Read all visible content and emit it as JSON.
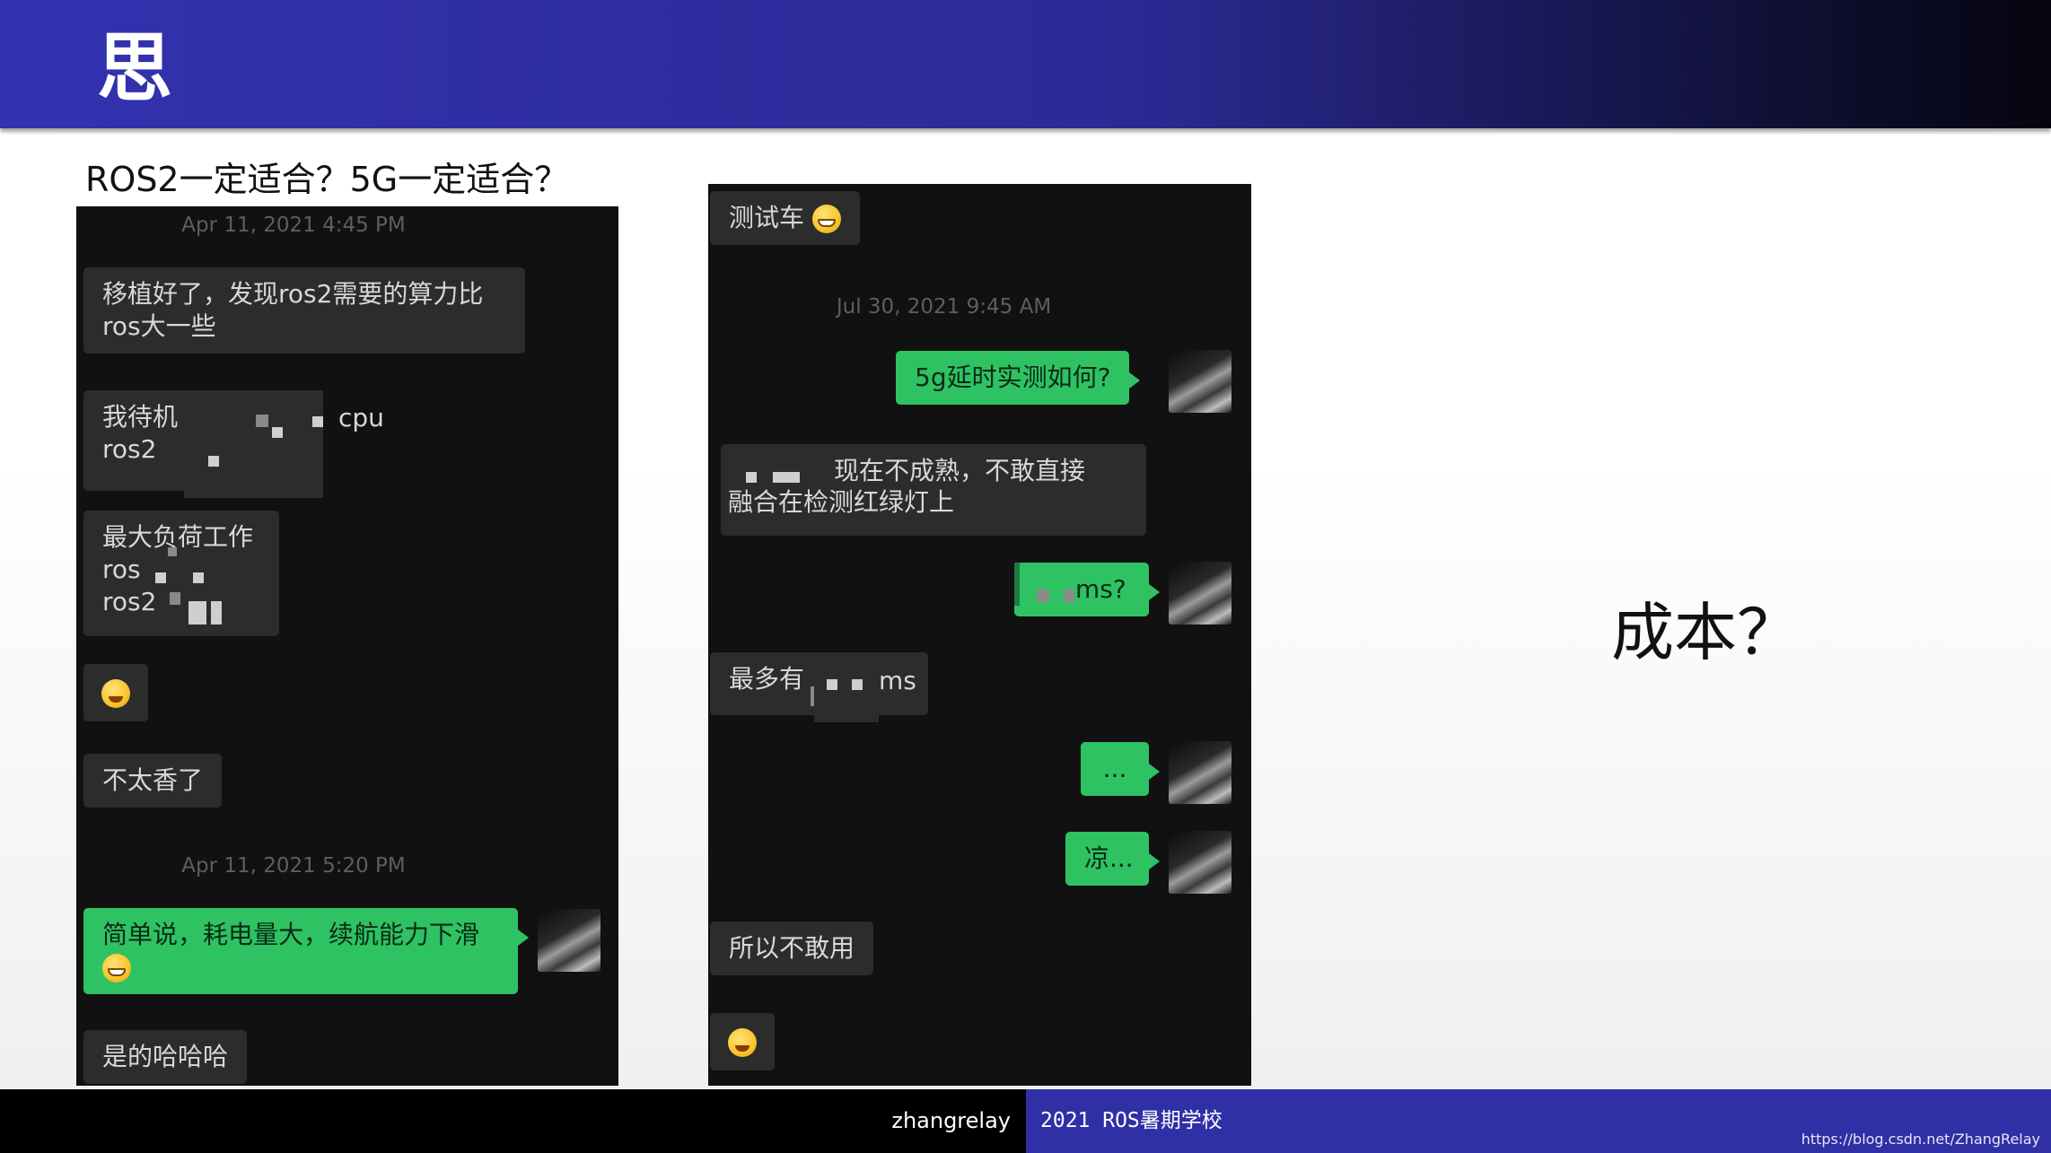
{
  "slide": {
    "title": "思",
    "question": "ROS2一定适合？5G一定适合？",
    "side_note": "成本？"
  },
  "left_chat": {
    "timestamp_1": "Apr 11, 2021 4:45 PM",
    "msg_1": "移植好了，发现ros2需要的算力比ros大一些",
    "msg_2_line1": "我待机 ros需",
    "msg_2_tail": "cpu",
    "msg_2_line2": "ros2",
    "msg_3_line1": "最大负荷工作",
    "msg_3_line2": "ros",
    "msg_3_line3": "ros2",
    "msg_5": "不太香了",
    "timestamp_2": "Apr 11, 2021 5:20 PM",
    "msg_6": "简单说，耗电量大，续航能力下滑",
    "msg_7": "是的哈哈哈"
  },
  "right_chat": {
    "msg_1": "测试车",
    "timestamp_1": "Jul 30, 2021 9:45 AM",
    "msg_2": "5g延时实测如何?",
    "msg_3_line1": "现在不成熟，不敢直接",
    "msg_3_line2": "融合在检测红绿灯上",
    "msg_4": "ms?",
    "msg_5_head": "最多有",
    "msg_5_tail": "ms",
    "msg_6": "...",
    "msg_7": "凉...",
    "msg_8": "所以不敢用"
  },
  "footer": {
    "author": "zhangrelay",
    "school": "2021 ROS暑期学校",
    "url": "https://blog.csdn.net/ZhangRelay"
  },
  "colors": {
    "header_blue": "#3232b0",
    "chat_bg": "#111111",
    "bubble_other": "#2c2c2c",
    "bubble_me": "#2ec263",
    "footer_blue": "#2f2fa6"
  }
}
